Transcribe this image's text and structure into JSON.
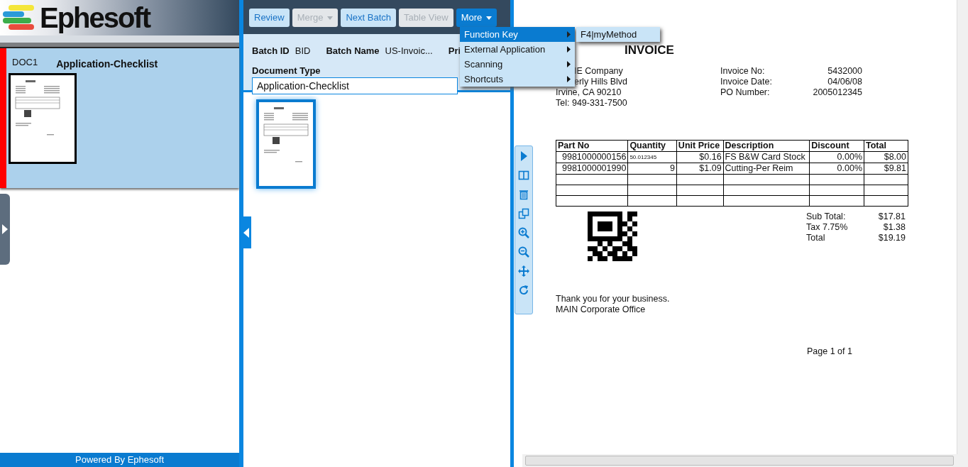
{
  "logo": {
    "text": "Ephesoft"
  },
  "documents": [
    {
      "id": "DOC1",
      "type": "Application-Checklist",
      "selected": true
    }
  ],
  "footer": "Powered By Ephesoft",
  "toolbar": [
    {
      "label": "Review",
      "disabled": false,
      "dropdown": false,
      "active": false
    },
    {
      "label": "Merge",
      "disabled": true,
      "dropdown": true,
      "active": false
    },
    {
      "label": "Next Batch",
      "disabled": false,
      "dropdown": false,
      "active": false
    },
    {
      "label": "Table View",
      "disabled": true,
      "dropdown": false,
      "active": false
    },
    {
      "label": "More",
      "disabled": false,
      "dropdown": true,
      "active": true
    }
  ],
  "batch_fields": [
    {
      "label": "Batch ID",
      "value": "BID"
    },
    {
      "label": "Batch Name",
      "value": "US-Invoic..."
    },
    {
      "label": "Pri"
    }
  ],
  "document_type": {
    "label": "Document Type",
    "value": "Application-Checklist"
  },
  "pages": [
    {
      "selected": true
    }
  ],
  "menu": [
    {
      "label": "Function Key",
      "selected": true,
      "children": [
        {
          "label": "F4|myMethod"
        }
      ]
    },
    {
      "label": "External Application",
      "selected": false
    },
    {
      "label": "Scanning",
      "selected": false
    },
    {
      "label": "Shortcuts",
      "selected": false
    }
  ],
  "invoice": {
    "title": "INVOICE",
    "address": [
      {
        "text": "IE Company",
        "covered": true
      },
      {
        "text": "erly Hills Blvd",
        "covered": true
      },
      {
        "text": "Irvine, CA 90210"
      },
      {
        "text": "Tel: 949-331-7500"
      }
    ],
    "meta": [
      {
        "label": "Invoice No:",
        "value": "5432000"
      },
      {
        "label": "Invoice Date:",
        "value": "04/06/08"
      },
      {
        "label": "PO Number:",
        "value": "2005012345"
      }
    ],
    "columns": [
      "Part No",
      "Quantity",
      "Unit Price",
      "Description",
      "Discount",
      "Total"
    ],
    "rows": [
      [
        "9981000000156",
        "50.012345",
        "$0.16",
        "FS B&W Card Stock",
        "0.00%",
        "$8.00"
      ],
      [
        "9981000001990",
        "9",
        "$1.09",
        "Cutting-Per Reim",
        "0.00%",
        "$9.81"
      ]
    ],
    "totals": [
      {
        "label": "Sub Total:",
        "value": "$17.81"
      },
      {
        "label": "Tax 7.75%",
        "value": "$1.38"
      },
      {
        "label": "Total",
        "value": "$19.19"
      }
    ],
    "notes": [
      "Thank you for your business.",
      "MAIN Corporate Office"
    ],
    "page_label": "Page 1 of 1"
  }
}
